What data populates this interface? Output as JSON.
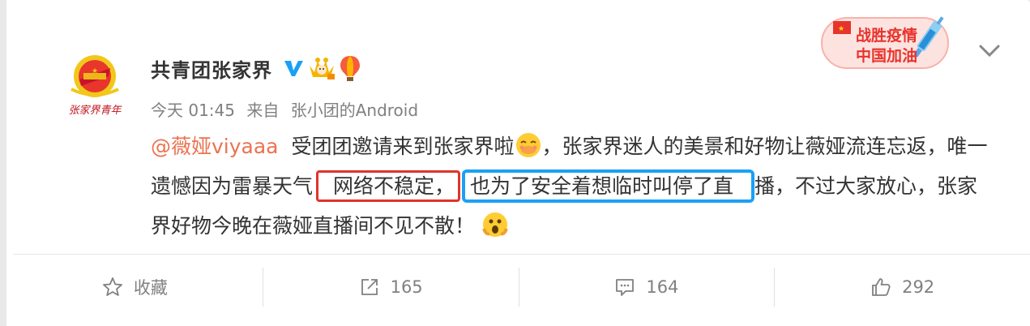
{
  "post": {
    "author": "共青团张家界",
    "avatar_text": "张家界青年",
    "time": "今天 01:45",
    "source_prefix": "来自",
    "source": "张小团的Android",
    "mention": "@薇娅viyaaa",
    "text_1": "受团团邀请来到张家界啦",
    "text_2": "，张家界迷人的美景和好物让薇娅流连忘返，唯一遗憾因为雷暴天气",
    "highlight_red": "网络不稳定，",
    "highlight_blue": "也为了安全着想临时叫停了直",
    "text_3": "播，不过大家放心，张家界好物今晚在薇娅直播间不见不散！"
  },
  "badge": {
    "line1": "战胜疫情",
    "line2": "中国加油"
  },
  "actions": {
    "favorite": "收藏",
    "repost": "165",
    "comment": "164",
    "like": "292"
  },
  "colors": {
    "mention": "#eb7350",
    "red_box": "#e0342c",
    "blue_box": "#1aa0f6",
    "verified": "#1aa0f6"
  }
}
